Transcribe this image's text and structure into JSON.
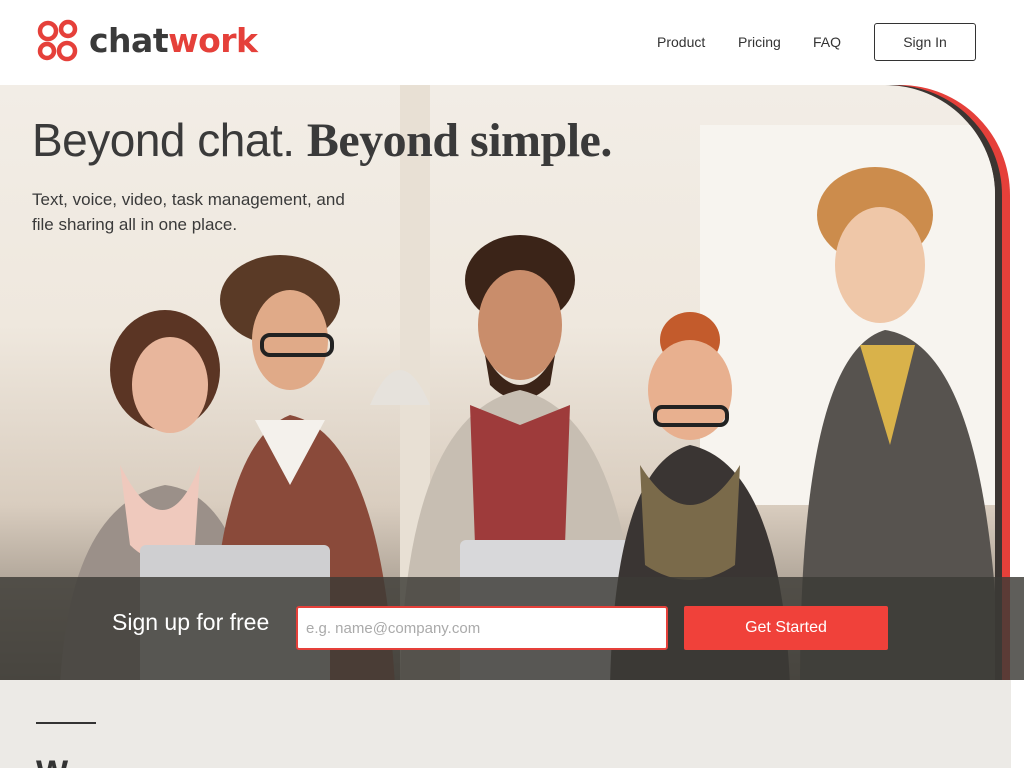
{
  "header": {
    "logo": {
      "text_chat": "chat",
      "text_work": "work",
      "icon": "chatwork-logo-icon"
    },
    "nav": [
      {
        "label": "Product"
      },
      {
        "label": "Pricing"
      },
      {
        "label": "FAQ"
      }
    ],
    "signin_label": "Sign In"
  },
  "hero": {
    "headline_light": "Beyond chat.",
    "headline_bold": "Beyond simple.",
    "subhead": "Text, voice, video, task management, and file sharing all in one place.",
    "signup": {
      "label": "Sign up for free",
      "email_placeholder": "e.g. name@company.com",
      "email_value": "",
      "button_label": "Get Started"
    }
  },
  "section": {
    "title": "W"
  },
  "colors": {
    "brand_red": "#e5403a",
    "text_dark": "#3a3a3a",
    "signup_bar": "#3c3a36",
    "section_bg": "#eceae6"
  }
}
